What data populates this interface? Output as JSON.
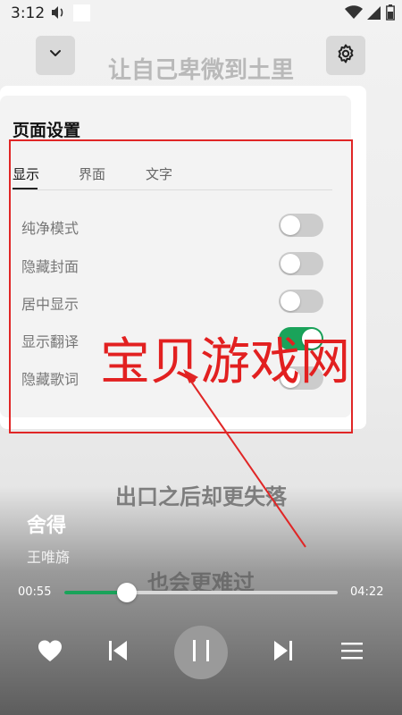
{
  "status_bar": {
    "time": "3:12"
  },
  "lyrics": {
    "top": "让自己卑微到土里",
    "middle": "出口之后却更失落",
    "lower": "也会更难过"
  },
  "settings_panel": {
    "title": "页面设置",
    "tabs": [
      {
        "label": "显示",
        "active": true
      },
      {
        "label": "界面",
        "active": false
      },
      {
        "label": "文字",
        "active": false
      }
    ],
    "items": [
      {
        "label": "纯净模式",
        "on": false
      },
      {
        "label": "隐藏封面",
        "on": false
      },
      {
        "label": "居中显示",
        "on": false
      },
      {
        "label": "显示翻译",
        "on": true
      },
      {
        "label": "隐藏歌词",
        "on": false
      }
    ]
  },
  "watermark": {
    "text": "宝贝游戏网"
  },
  "player": {
    "song_title": "舍得",
    "artist": "王唯旖",
    "current_time": "00:55",
    "total_time": "04:22",
    "progress_fraction": 0.23
  },
  "colors": {
    "accent": "#1aa35a",
    "annotation": "#e02626"
  },
  "icons": {
    "collapse": "chevron-down-icon",
    "settings": "gear-icon",
    "like": "heart-icon",
    "prev": "skip-previous-icon",
    "pause": "pause-icon",
    "next": "skip-next-icon",
    "playlist": "playlist-icon"
  }
}
